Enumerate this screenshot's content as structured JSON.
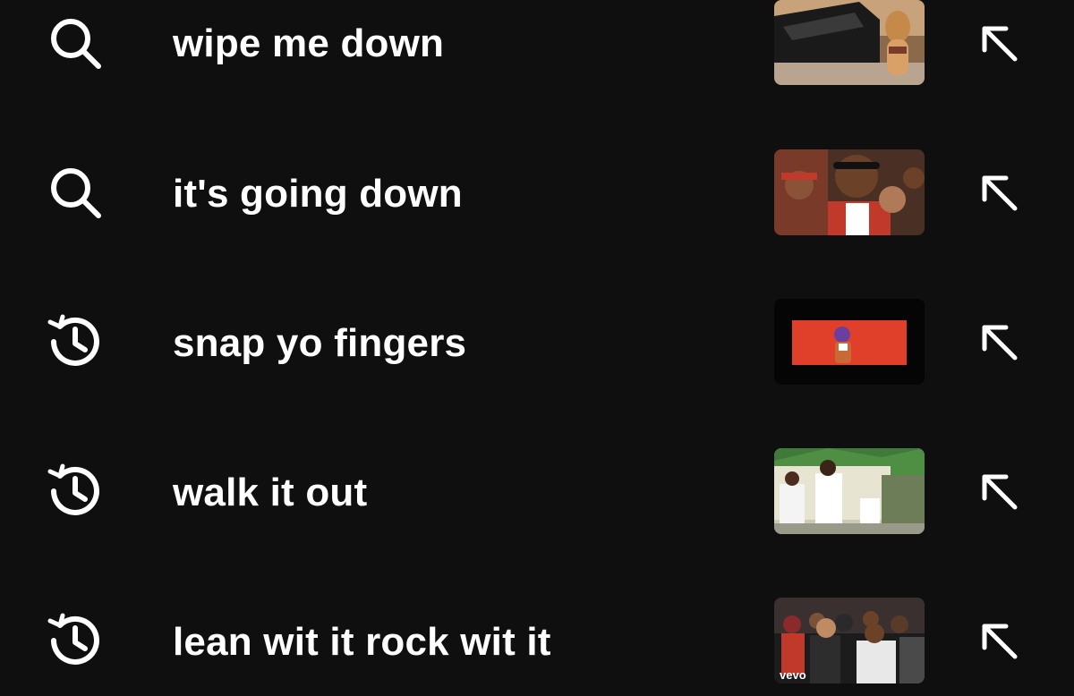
{
  "suggestions": [
    {
      "query": "wipe me down",
      "type": "search",
      "icon": "search-icon",
      "thumbnail": "video-thumbnail"
    },
    {
      "query": "it's going down",
      "type": "search",
      "icon": "search-icon",
      "thumbnail": "video-thumbnail"
    },
    {
      "query": "snap yo fingers",
      "type": "history",
      "icon": "history-icon",
      "thumbnail": "video-thumbnail"
    },
    {
      "query": "walk it out",
      "type": "history",
      "icon": "history-icon",
      "thumbnail": "video-thumbnail"
    },
    {
      "query": "lean wit it rock wit it",
      "type": "history",
      "icon": "history-icon",
      "thumbnail": "video-thumbnail",
      "thumbnail_badge": "vevo"
    }
  ],
  "fill_icon": "arrow-up-left-icon",
  "colors": {
    "background": "#0f0f0f",
    "text": "#ffffff"
  }
}
